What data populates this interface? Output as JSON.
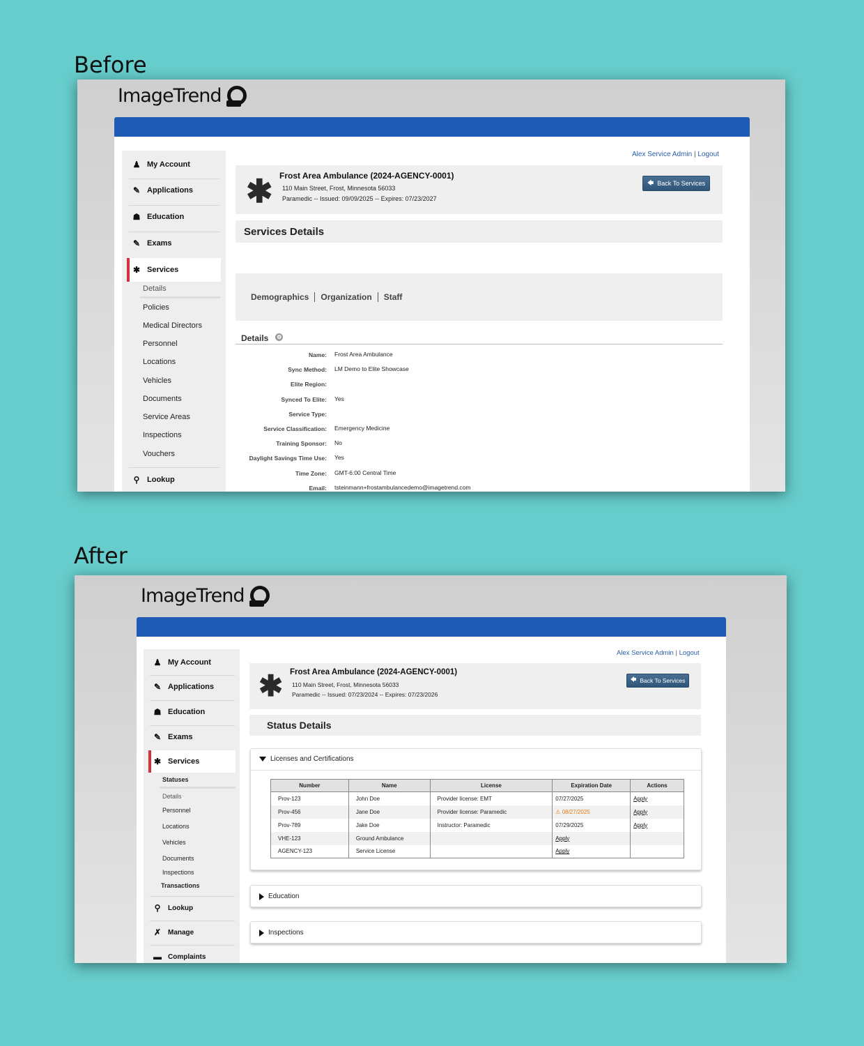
{
  "captions": {
    "before": "Before",
    "after": "After"
  },
  "brand": {
    "logo_text": "ImageTrend"
  },
  "colors": {
    "background": "#66cdcc",
    "brand_blue": "#1d5bb5",
    "active_marker": "#d32f3f",
    "warning": "#e07b14"
  },
  "before": {
    "toplinks": {
      "user": "Alex Service Admin",
      "separator": "|",
      "logout": "Logout"
    },
    "header": {
      "title": "Frost Area Ambulance (2024-AGENCY-0001)",
      "address": "110 Main Street, Frost, Minnesota 56033",
      "license_line": "Paramedic -- Issued: 09/09/2025 -- Expires: 07/23/2027",
      "back_button": "Back To Services"
    },
    "nav": {
      "my_account": "My Account",
      "applications": "Applications",
      "education": "Education",
      "exams": "Exams",
      "services": "Services",
      "sub_items": [
        "Details",
        "Policies",
        "Medical Directors",
        "Personnel",
        "Locations",
        "Vehicles",
        "Documents",
        "Service Areas",
        "Inspections",
        "Vouchers"
      ],
      "lookup": "Lookup"
    },
    "section_title": "Services Details",
    "tabs": [
      "Demographics",
      "Organization",
      "Staff"
    ],
    "details_heading": "Details",
    "fields": [
      {
        "label": "Name:",
        "value": "Frost Area Ambulance"
      },
      {
        "label": "Sync Method:",
        "value": "LM Demo to Elite Showcase"
      },
      {
        "label": "Elite Region:",
        "value": ""
      },
      {
        "label": "Synced To Elite:",
        "value": "Yes"
      },
      {
        "label": "Service Type:",
        "value": ""
      },
      {
        "label": "Service Classification:",
        "value": "Emergency Medicine"
      },
      {
        "label": "Training Sponsor:",
        "value": "No"
      },
      {
        "label": "Daylight Savings Time Use:",
        "value": "Yes"
      },
      {
        "label": "Time Zone:",
        "value": "GMT-6:00 Central Time"
      },
      {
        "label": "Email:",
        "value": "tsteinmann+frostambulancedemo@imagetrend.com"
      }
    ]
  },
  "after": {
    "toplinks": {
      "user": "Alex Service Admin",
      "separator": "|",
      "logout": "Logout"
    },
    "header": {
      "title": "Frost Area Ambulance (2024-AGENCY-0001)",
      "address": "110 Main Street, Frost, Minnesota 56033",
      "license_line": "Paramedic -- Issued: 07/23/2024 -- Expires: 07/23/2026",
      "back_button": "Back To Services"
    },
    "nav": {
      "my_account": "My Account",
      "applications": "Applications",
      "education": "Education",
      "exams": "Exams",
      "services": "Services",
      "sub_items": [
        "Statuses",
        "Details",
        "Personnel",
        "Locations",
        "Vehicles",
        "Documents",
        "Inspections",
        "Transactions"
      ],
      "lookup": "Lookup",
      "manage": "Manage",
      "complaints": "Complaints"
    },
    "section_title": "Status Details",
    "accordions": {
      "licenses": "Licenses and Certifications",
      "education": "Education",
      "inspections": "Inspections"
    },
    "table": {
      "headers": [
        "Number",
        "Name",
        "License",
        "Expiration Date",
        "Actions"
      ],
      "rows": [
        {
          "number": "Prov-123",
          "name": "John Doe",
          "license": "Provider license: EMT",
          "expiration": "07/27/2025",
          "action": "Apply"
        },
        {
          "number": "Prov-456",
          "name": "Jane Doe",
          "license": "Provider license: Paramedic",
          "expiration": "08/27/2025",
          "action": "Apply"
        },
        {
          "number": "Prov-789",
          "name": "Jake Doe",
          "license": "Instructor: Paramedic",
          "expiration": "07/29/2025",
          "action": "Apply"
        },
        {
          "number": "VHE-123",
          "name": "Ground Ambulance",
          "license": "",
          "expiration": "Apply",
          "action": ""
        },
        {
          "number": "AGENCY-123",
          "name": "Service License",
          "license": "",
          "expiration": "Apply",
          "action": ""
        }
      ]
    }
  }
}
